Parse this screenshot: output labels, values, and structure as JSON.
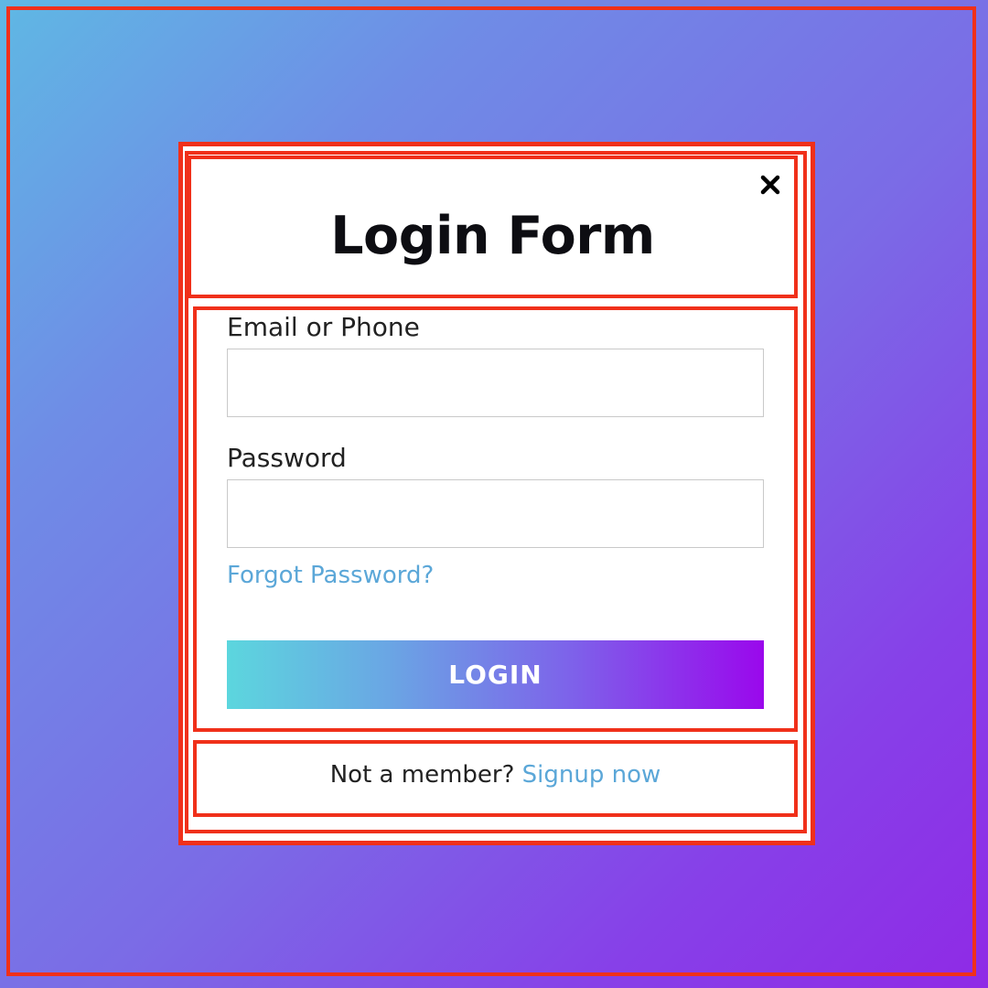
{
  "modal": {
    "title": "Login Form",
    "close_icon": "close-icon"
  },
  "form": {
    "email_label": "Email or Phone",
    "email_value": "",
    "password_label": "Password",
    "password_value": "",
    "forgot_link": "Forgot Password?",
    "login_button": "LOGIN"
  },
  "footer": {
    "prompt": "Not a member?",
    "signup_link": "Signup now"
  },
  "colors": {
    "link": "#5ba7d8",
    "annotation_border": "#f0301a",
    "button_gradient_start": "#5cd6de",
    "button_gradient_end": "#9a08ec"
  }
}
